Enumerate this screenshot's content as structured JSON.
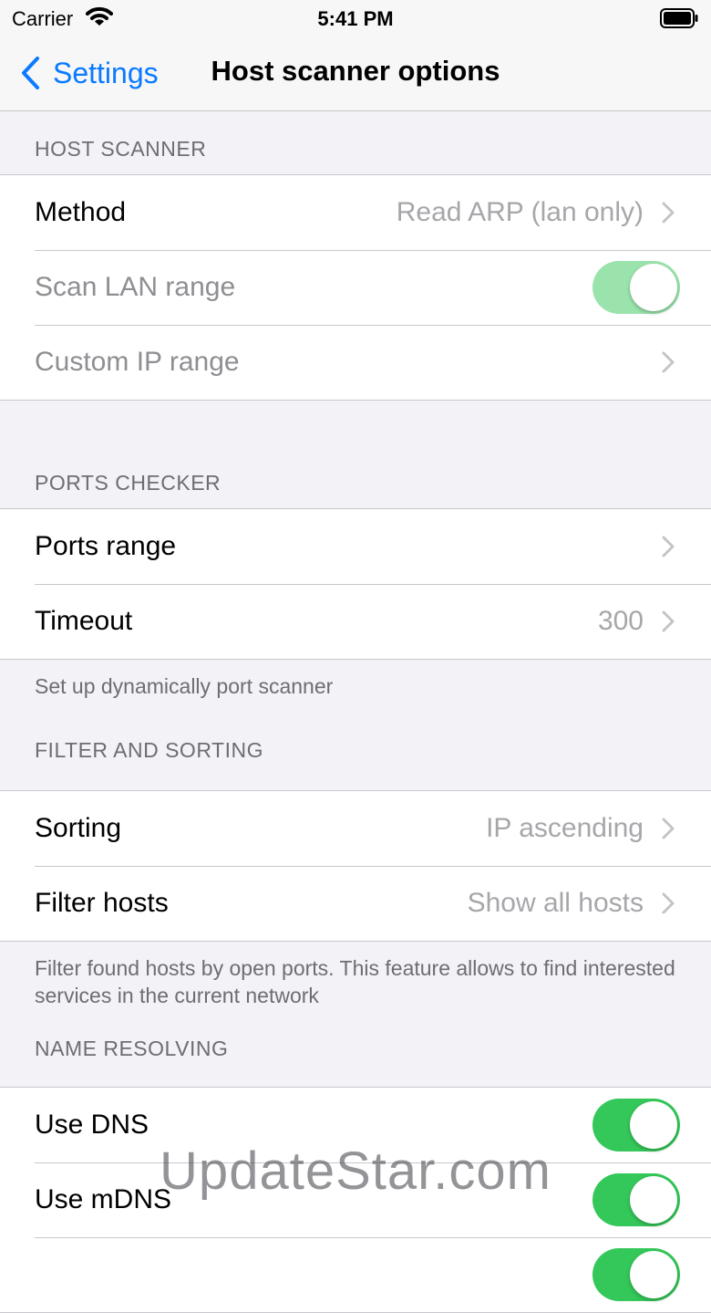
{
  "status_bar": {
    "carrier": "Carrier",
    "time": "5:41 PM"
  },
  "nav": {
    "back_label": "Settings",
    "title": "Host scanner options"
  },
  "sections": {
    "host_scanner": {
      "header": "HOST SCANNER",
      "method": {
        "label": "Method",
        "value": "Read ARP (lan only)"
      },
      "scan_lan": {
        "label": "Scan LAN range",
        "enabled": true
      },
      "custom_ip": {
        "label": "Custom IP range"
      }
    },
    "ports_checker": {
      "header": "PORTS CHECKER",
      "ports_range": {
        "label": "Ports range"
      },
      "timeout": {
        "label": "Timeout",
        "value": "300"
      },
      "footer": "Set up dynamically port scanner"
    },
    "filter_sorting": {
      "header": "FILTER AND SORTING",
      "sorting": {
        "label": "Sorting",
        "value": "IP ascending"
      },
      "filter_hosts": {
        "label": "Filter hosts",
        "value": "Show all hosts"
      },
      "footer": "Filter found hosts by open ports. This feature allows to find interested services in the current network"
    },
    "name_resolving": {
      "header": "NAME RESOLVING",
      "use_dns": {
        "label": "Use DNS",
        "enabled": true
      },
      "use_mdns": {
        "label": "Use mDNS",
        "enabled": true
      },
      "third_toggle": {
        "enabled": true
      }
    }
  },
  "watermark": "UpdateStar.com",
  "colors": {
    "accent": "#0a7aff",
    "toggle_on": "#34c759",
    "toggle_disabled": "#9be3ac"
  }
}
